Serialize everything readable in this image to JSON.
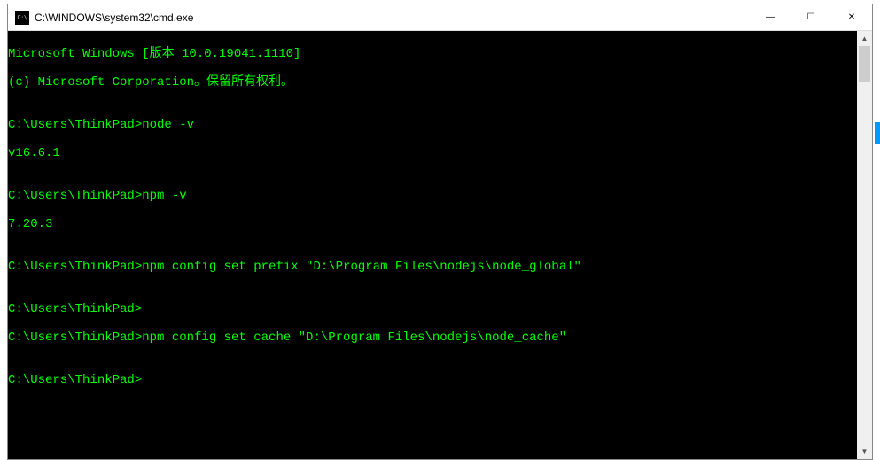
{
  "window": {
    "icon_label": "C:\\",
    "title": "C:\\WINDOWS\\system32\\cmd.exe"
  },
  "controls": {
    "minimize": "—",
    "maximize": "☐",
    "close": "✕"
  },
  "scrollbar": {
    "up": "▲",
    "down": "▼"
  },
  "console": {
    "lines": [
      "Microsoft Windows [版本 10.0.19041.1110]",
      "(c) Microsoft Corporation。保留所有权利。",
      "",
      "C:\\Users\\ThinkPad>node -v",
      "v16.6.1",
      "",
      "C:\\Users\\ThinkPad>npm -v",
      "7.20.3",
      "",
      "C:\\Users\\ThinkPad>npm config set prefix \"D:\\Program Files\\nodejs\\node_global\"",
      "",
      "C:\\Users\\ThinkPad>",
      "C:\\Users\\ThinkPad>npm config set cache \"D:\\Program Files\\nodejs\\node_cache\"",
      "",
      "C:\\Users\\ThinkPad>"
    ]
  }
}
